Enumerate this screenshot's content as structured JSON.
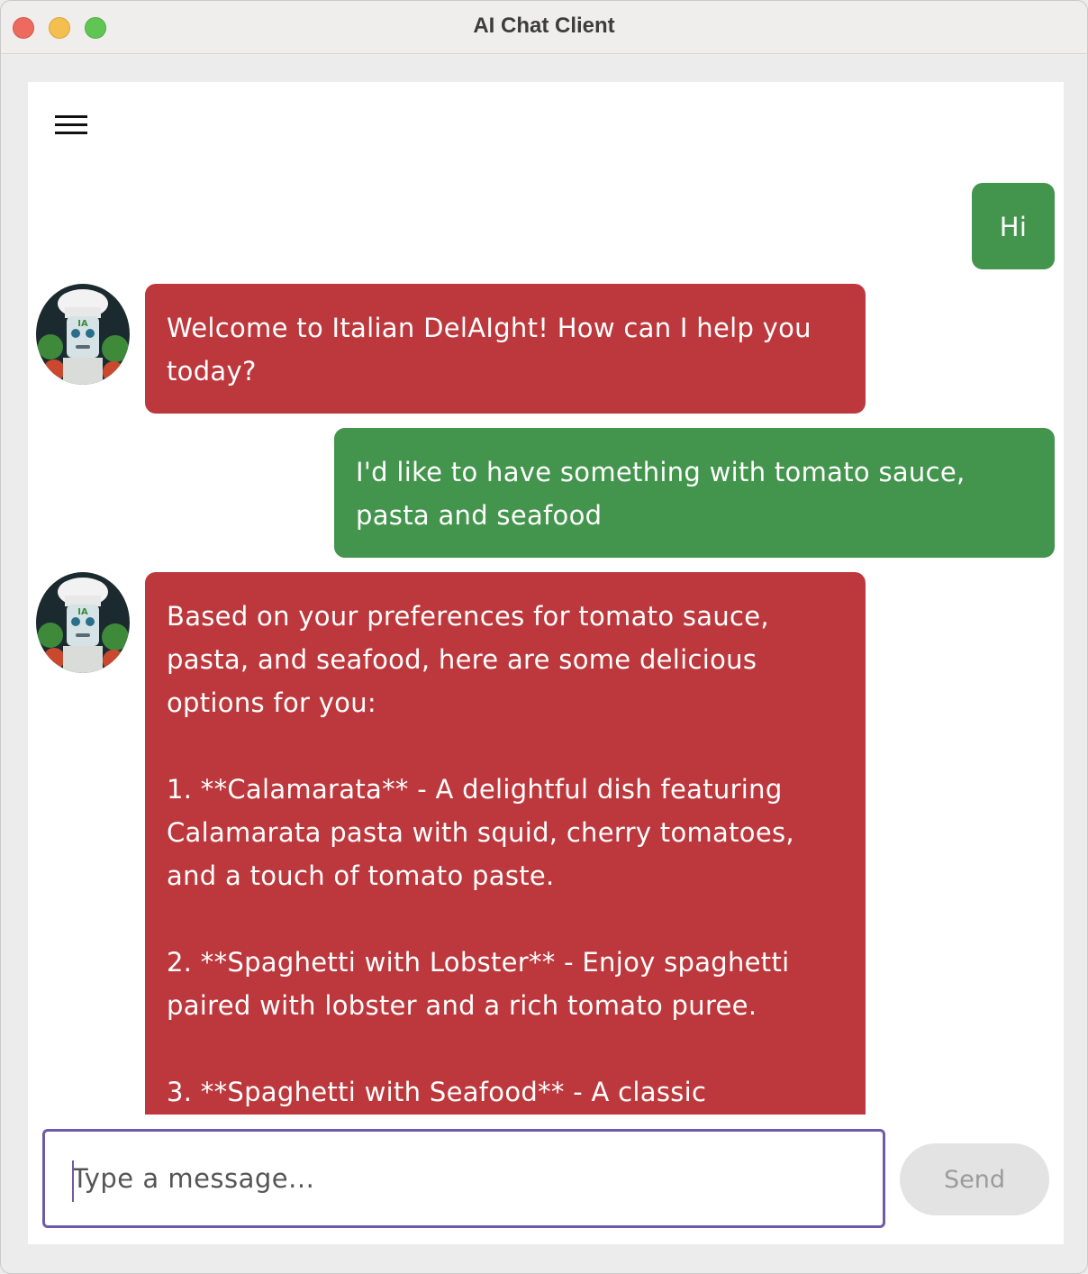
{
  "window": {
    "title": "AI Chat Client"
  },
  "header": {
    "menu_icon": "hamburger-menu-icon"
  },
  "messages": [
    {
      "role": "user",
      "text": "Hi"
    },
    {
      "role": "bot",
      "avatar": "chef-robot-avatar",
      "text": "Welcome to Italian DelAIght! How can I help you today?"
    },
    {
      "role": "user",
      "text": "I'd like to have something with tomato sauce, pasta and seafood"
    },
    {
      "role": "bot",
      "avatar": "chef-robot-avatar",
      "text": "Based on your preferences for tomato sauce, pasta, and seafood, here are some delicious options for you:\n\n1. **Calamarata** - A delightful dish featuring Calamarata pasta with squid, cherry tomatoes, and a touch of tomato paste.\n\n2. **Spaghetti with Lobster** - Enjoy spaghetti paired with lobster and a rich tomato puree.\n\n3. **Spaghetti with Seafood** - A classic"
    }
  ],
  "avatar_badge": "IA",
  "composer": {
    "placeholder": "Type a message...",
    "value": "",
    "send_label": "Send"
  },
  "colors": {
    "user_bubble": "#43954d",
    "bot_bubble": "#bd383d",
    "input_border": "#6e5aa8",
    "send_disabled_bg": "#e3e3e3"
  }
}
